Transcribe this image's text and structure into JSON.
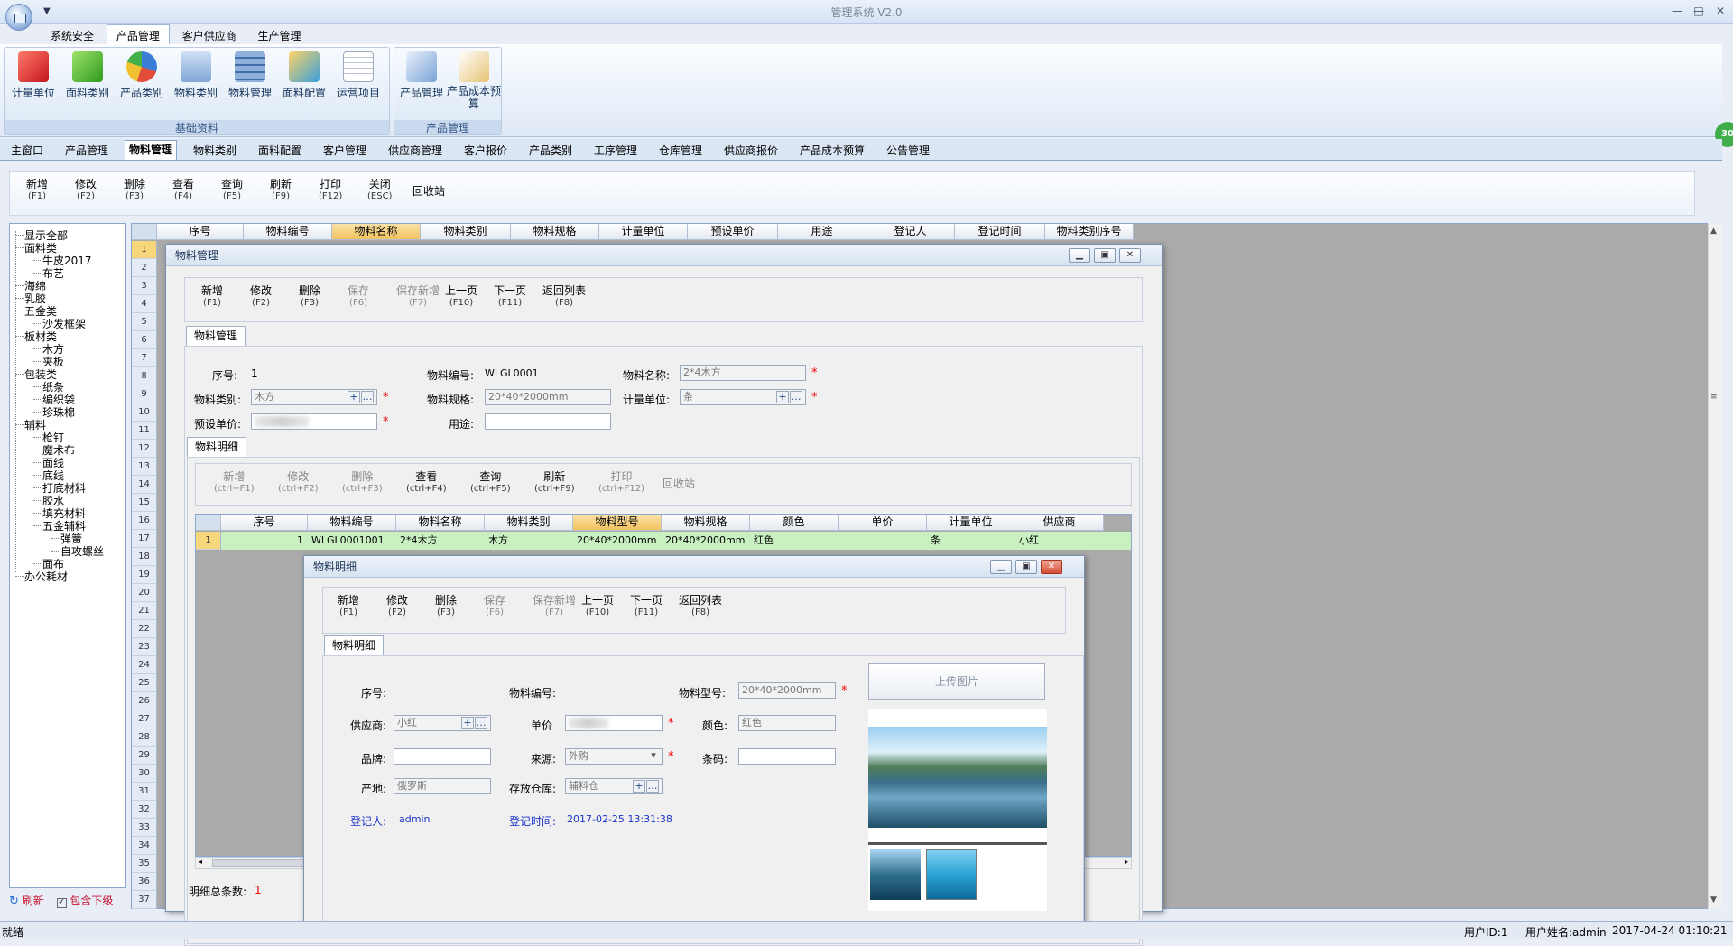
{
  "app": {
    "title": "管理系统 V2.0",
    "quick_access": "▼",
    "win_controls": [
      "—",
      "□",
      "✕"
    ]
  },
  "menu_tabs": [
    {
      "label": "系统安全",
      "active": false
    },
    {
      "label": "产品管理",
      "active": true
    },
    {
      "label": "客户供应商",
      "active": false
    },
    {
      "label": "生产管理",
      "active": false
    }
  ],
  "ribbon": {
    "groups": [
      {
        "title": "基础资料",
        "buttons": [
          "计量单位",
          "面料类别",
          "产品类别",
          "物料类别",
          "物料管理",
          "面料配置",
          "运营项目"
        ]
      },
      {
        "title": "产品管理",
        "buttons": [
          "产品管理",
          "产品成本预算"
        ]
      }
    ],
    "side_badge": "30"
  },
  "doc_tabs": [
    "主窗口",
    "产品管理",
    "物料管理",
    "物料类别",
    "面料配置",
    "客户管理",
    "供应商管理",
    "客户报价",
    "产品类别",
    "工序管理",
    "仓库管理",
    "供应商报价",
    "产品成本预算",
    "公告管理"
  ],
  "doc_tab_active": "物料管理",
  "main_toolbar": [
    {
      "label": "新增",
      "key": "(F1)"
    },
    {
      "label": "修改",
      "key": "(F2)"
    },
    {
      "label": "删除",
      "key": "(F3)"
    },
    {
      "label": "查看",
      "key": "(F4)"
    },
    {
      "label": "查询",
      "key": "(F5)"
    },
    {
      "label": "刷新",
      "key": "(F9)"
    },
    {
      "label": "打印",
      "key": "(F12)"
    },
    {
      "label": "关闭",
      "key": "(ESC)"
    },
    {
      "label": "回收站",
      "key": ""
    }
  ],
  "tree": [
    {
      "label": "显示全部",
      "level": 0
    },
    {
      "label": "面料类",
      "level": 0
    },
    {
      "label": "牛皮2017",
      "level": 1
    },
    {
      "label": "布艺",
      "level": 1
    },
    {
      "label": "海绵",
      "level": 0
    },
    {
      "label": "乳胶",
      "level": 0
    },
    {
      "label": "五金类",
      "level": 0
    },
    {
      "label": "沙发框架",
      "level": 1
    },
    {
      "label": "板材类",
      "level": 0
    },
    {
      "label": "木方",
      "level": 1
    },
    {
      "label": "夹板",
      "level": 1
    },
    {
      "label": "包装类",
      "level": 0
    },
    {
      "label": "纸条",
      "level": 1
    },
    {
      "label": "编织袋",
      "level": 1
    },
    {
      "label": "珍珠棉",
      "level": 1
    },
    {
      "label": "辅料",
      "level": 0
    },
    {
      "label": "枪钉",
      "level": 1
    },
    {
      "label": "魔术布",
      "level": 1
    },
    {
      "label": "面线",
      "level": 1
    },
    {
      "label": "底线",
      "level": 1
    },
    {
      "label": "打底材料",
      "level": 1
    },
    {
      "label": "胶水",
      "level": 1
    },
    {
      "label": "填充材料",
      "level": 1
    },
    {
      "label": "五金辅料",
      "level": 1
    },
    {
      "label": "弹簧",
      "level": 2
    },
    {
      "label": "自攻螺丝",
      "level": 2
    },
    {
      "label": "面布",
      "level": 1
    },
    {
      "label": "办公耗材",
      "level": 0
    }
  ],
  "tree_bottom": {
    "refresh": "刷新",
    "include_sub": "包含下级"
  },
  "main_grid": {
    "columns": [
      "序号",
      "物料编号",
      "物料名称",
      "物料类别",
      "物料规格",
      "计量单位",
      "预设单价",
      "用途",
      "登记人",
      "登记时间",
      "物料类别序号"
    ],
    "row_numbers": [
      "1",
      "2",
      "3",
      "4",
      "5",
      "6",
      "7",
      "8",
      "9",
      "10",
      "11",
      "12",
      "13",
      "14",
      "15",
      "16",
      "17",
      "18",
      "19",
      "20",
      "21",
      "22",
      "23",
      "24",
      "25",
      "26",
      "27",
      "28",
      "29",
      "30",
      "31",
      "32",
      "33",
      "34",
      "35",
      "36",
      "37"
    ]
  },
  "material_window": {
    "title": "物料管理",
    "toolbar": [
      {
        "label": "新增",
        "key": "(F1)",
        "enabled": true
      },
      {
        "label": "修改",
        "key": "(F2)",
        "enabled": true
      },
      {
        "label": "删除",
        "key": "(F3)",
        "enabled": true
      },
      {
        "label": "保存",
        "key": "(F6)",
        "enabled": false
      },
      {
        "label": "保存新增",
        "key": "(F7)",
        "enabled": false
      },
      {
        "label": "上一页",
        "key": "(F10)",
        "enabled": true
      },
      {
        "label": "下一页",
        "key": "(F11)",
        "enabled": true
      },
      {
        "label": "返回列表",
        "key": "(F8)",
        "enabled": true
      }
    ],
    "tab": "物料管理",
    "fields": {
      "seq_label": "序号:",
      "seq_value": "1",
      "code_label": "物料编号:",
      "code_value": "WLGL0001",
      "name_label": "物料名称:",
      "name_value": "2*4木方",
      "category_label": "物料类别:",
      "category_value": "木方",
      "spec_label": "物料规格:",
      "spec_value": "20*40*2000mm",
      "unit_label": "计量单位:",
      "unit_value": "条",
      "price_label": "预设单价:",
      "price_value": "",
      "use_label": "用途:",
      "use_value": ""
    },
    "detail_tab": "物料明细",
    "detail_toolbar": [
      {
        "label": "新增",
        "key": "(ctrl+F1)",
        "enabled": false
      },
      {
        "label": "修改",
        "key": "(ctrl+F2)",
        "enabled": false
      },
      {
        "label": "删除",
        "key": "(ctrl+F3)",
        "enabled": false
      },
      {
        "label": "查看",
        "key": "(ctrl+F4)",
        "enabled": true
      },
      {
        "label": "查询",
        "key": "(ctrl+F5)",
        "enabled": true
      },
      {
        "label": "刷新",
        "key": "(ctrl+F9)",
        "enabled": true
      },
      {
        "label": "打印",
        "key": "(ctrl+F12)",
        "enabled": false
      },
      {
        "label": "回收站",
        "key": "",
        "enabled": false
      }
    ],
    "detail_columns": [
      "序号",
      "物料编号",
      "物料名称",
      "物料类别",
      "物料型号",
      "物料规格",
      "颜色",
      "单价",
      "计量单位",
      "供应商"
    ],
    "detail_rows": [
      {
        "rownum": "1",
        "seq": "1",
        "code": "WLGL0001001",
        "name": "2*4木方",
        "category": "木方",
        "model": "20*40*2000mm",
        "spec": "20*40*2000mm",
        "color": "红色",
        "price": "",
        "unit": "条",
        "supplier": "小红"
      }
    ],
    "detail_total_label": "明细总条数:",
    "detail_total_value": "1"
  },
  "detail_window": {
    "title": "物料明细",
    "toolbar": [
      {
        "label": "新增",
        "key": "(F1)",
        "enabled": true
      },
      {
        "label": "修改",
        "key": "(F2)",
        "enabled": true
      },
      {
        "label": "删除",
        "key": "(F3)",
        "enabled": true
      },
      {
        "label": "保存",
        "key": "(F6)",
        "enabled": false
      },
      {
        "label": "保存新增",
        "key": "(F7)",
        "enabled": false
      },
      {
        "label": "上一页",
        "key": "(F10)",
        "enabled": true
      },
      {
        "label": "下一页",
        "key": "(F11)",
        "enabled": true
      },
      {
        "label": "返回列表",
        "key": "(F8)",
        "enabled": true
      }
    ],
    "tab": "物料明细",
    "fields": {
      "seq_label": "序号:",
      "seq_value": "",
      "code_label": "物料编号:",
      "code_value": "",
      "model_label": "物料型号:",
      "model_value": "20*40*2000mm",
      "supplier_label": "供应商:",
      "supplier_value": "小红",
      "price_label": "单价",
      "price_value": "",
      "color_label": "颜色:",
      "color_value": "红色",
      "brand_label": "品牌:",
      "brand_value": "",
      "source_label": "来源:",
      "source_value": "外购",
      "barcode_label": "条码:",
      "barcode_value": "",
      "origin_label": "产地:",
      "origin_value": "俄罗斯",
      "warehouse_label": "存放仓库:",
      "warehouse_value": "辅料仓",
      "register_label": "登记人:",
      "register_value": "admin",
      "regtime_label": "登记时间:",
      "regtime_value": "2017-02-25 13:31:38"
    },
    "upload_label": "上传图片"
  },
  "status": {
    "ready": "就绪",
    "user_id": "用户ID:1",
    "user_name": "用户姓名:admin",
    "datetime": "2017-04-24 01:10:21"
  },
  "colors": {
    "accent": "#2b5797",
    "selected_header": "#f7c96b",
    "selected_row": "#c9f0c0",
    "required": "#e00000",
    "blue_text": "#1a32c8"
  }
}
